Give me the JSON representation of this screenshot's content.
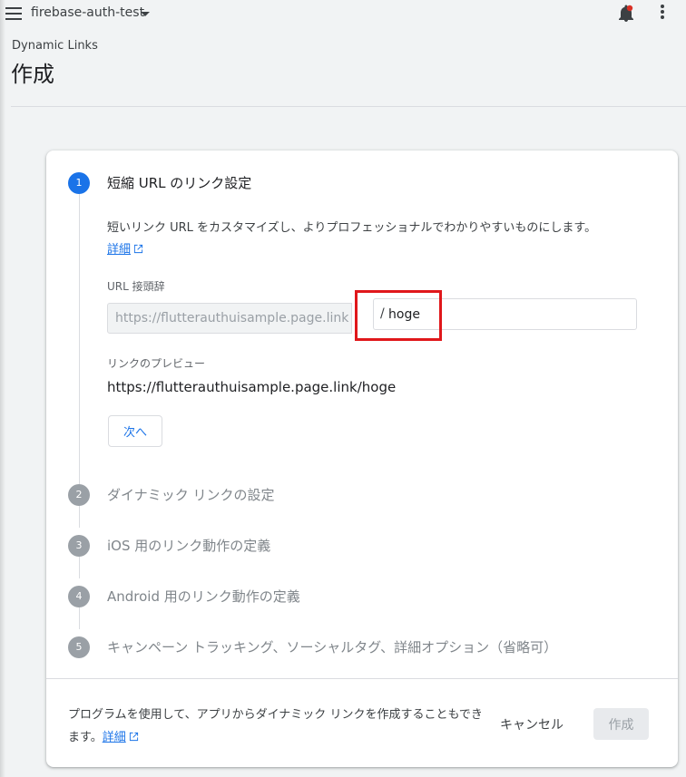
{
  "header": {
    "project_name": "firebase-auth-test",
    "breadcrumb": "Dynamic Links",
    "title": "作成"
  },
  "steps": [
    {
      "number": "1",
      "title": "短縮 URL のリンク設定",
      "state": "active"
    },
    {
      "number": "2",
      "title": "ダイナミック リンクの設定",
      "state": "inactive"
    },
    {
      "number": "3",
      "title": "iOS 用のリンク動作の定義",
      "state": "inactive"
    },
    {
      "number": "4",
      "title": "Android 用のリンク動作の定義",
      "state": "inactive"
    },
    {
      "number": "5",
      "title": "キャンペーン トラッキング、ソーシャルタグ、詳細オプション（省略可）",
      "state": "inactive"
    }
  ],
  "step1": {
    "description": "短いリンク URL をカスタマイズし、よりプロフェッショナルでわかりやすいものにします。",
    "learn_more": "詳細",
    "prefix_label": "URL 接頭辞",
    "prefix_value": "https://flutterauthuisample.page.link",
    "slash": "/",
    "suffix_value": "hoge",
    "preview_label": "リンクのプレビュー",
    "preview_value": "https://flutterauthuisample.page.link/hoge",
    "next_label": "次へ"
  },
  "footer": {
    "text": "プログラムを使用して、アプリからダイナミック リンクを作成することもできます。",
    "link": "詳細",
    "cancel_label": "キャンセル",
    "create_label": "作成"
  },
  "colors": {
    "accent": "#1a73e8",
    "highlight": "#e0171b",
    "notification_dot": "#d93025"
  }
}
